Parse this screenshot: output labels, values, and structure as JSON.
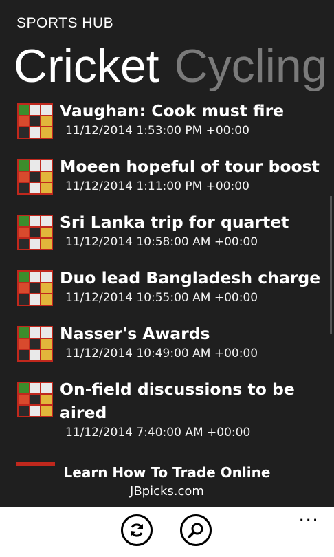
{
  "app": {
    "title": "SPORTS HUB"
  },
  "pivot": {
    "active": "Cricket",
    "next": "Cycling"
  },
  "news": [
    {
      "headline": "Vaughan: Cook must fire",
      "date": "11/12/2014 1:53:00 PM +00:00"
    },
    {
      "headline": "Moeen hopeful of tour boost",
      "date": "11/12/2014 1:11:00 PM +00:00"
    },
    {
      "headline": "Sri Lanka trip for quartet",
      "date": "11/12/2014 10:58:00 AM +00:00"
    },
    {
      "headline": "Duo lead Bangladesh charge",
      "date": "11/12/2014 10:55:00 AM +00:00"
    },
    {
      "headline": "Nasser's Awards",
      "date": "11/12/2014 10:49:00 AM +00:00"
    },
    {
      "headline": "On-field discussions to be aired",
      "date": "11/12/2014 7:40:00 AM +00:00"
    }
  ],
  "ad": {
    "title": "Learn How To Trade Online",
    "url": "JBpicks.com"
  },
  "appbar": {
    "buttons": [
      {
        "icon": "refresh-icon"
      },
      {
        "icon": "search-icon"
      }
    ],
    "more": "..."
  },
  "colors": {
    "background": "#1f1f1f",
    "appbar": "#ffffff",
    "thumb": "#c0281d"
  }
}
